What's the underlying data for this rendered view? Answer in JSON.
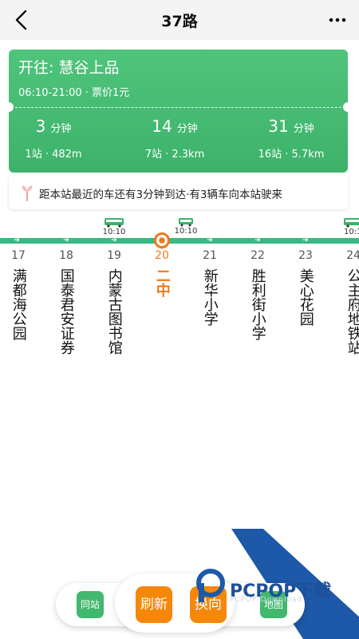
{
  "header": {
    "title": "37路"
  },
  "card": {
    "destination": "开往:  慧谷上品",
    "hours": "06:10-21:00 · 票价1元",
    "buses": [
      {
        "minutes": "3",
        "unit": "分钟",
        "distance": "1站 · 482m"
      },
      {
        "minutes": "14",
        "unit": "分钟",
        "distance": "7站 · 2.3km"
      },
      {
        "minutes": "31",
        "unit": "分钟",
        "distance": "16站 · 5.7km"
      }
    ]
  },
  "notice": {
    "text": "距本站最近的车还有3分钟到达·有3辆车向本站驶来"
  },
  "route": {
    "bus_times": [
      "10:10",
      "10:10",
      "10:1"
    ],
    "stops": [
      {
        "num": "17",
        "name": "满都海公园"
      },
      {
        "num": "18",
        "name": "国泰君安证券"
      },
      {
        "num": "19",
        "name": "内蒙古图书馆"
      },
      {
        "num": "20",
        "name": "二中"
      },
      {
        "num": "21",
        "name": "新华小学"
      },
      {
        "num": "22",
        "name": "胜利街小学"
      },
      {
        "num": "23",
        "name": "美心花园"
      },
      {
        "num": "24",
        "name": "公主府地铁站"
      }
    ]
  },
  "bottom": {
    "same_station": "同站",
    "refresh": "刷新",
    "reverse": "换向",
    "map": "地图"
  },
  "watermark": {
    "text": "PCPOP下载",
    "sub": "PCPOP Download"
  },
  "colors": {
    "accent": "#42b86e",
    "current": "#ee7a1c",
    "action": "#f5870a",
    "line": "#39b984"
  }
}
